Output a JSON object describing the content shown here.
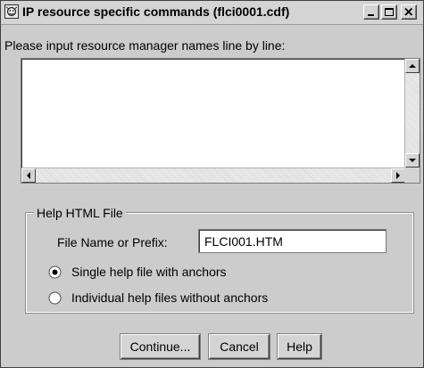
{
  "window": {
    "title": "IP resource specific commands (flci0001.cdf)",
    "controls": [
      "minimize-icon",
      "maximize-icon",
      "close-icon"
    ]
  },
  "prompt": {
    "label": "Please input resource manager names line by line:",
    "value": ""
  },
  "help_file": {
    "group_label": "Help HTML File",
    "field_label": "File Name or Prefix:",
    "field_value": "FLCI001.HTM",
    "options": [
      {
        "label": "Single help file with anchors",
        "selected": true
      },
      {
        "label": "Individual help files without anchors",
        "selected": false
      }
    ]
  },
  "buttons": {
    "continue": "Continue...",
    "cancel": "Cancel",
    "help": "Help"
  }
}
